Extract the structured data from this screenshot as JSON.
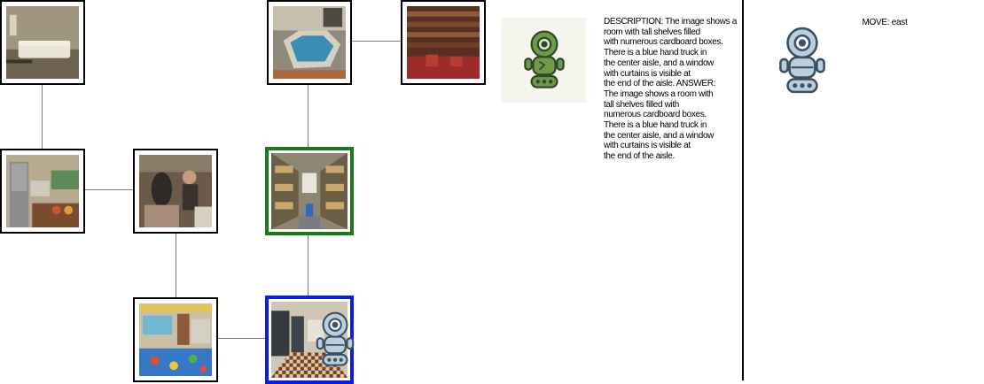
{
  "grid": {
    "nodes": [
      {
        "id": "living-room",
        "scene": "Living room with white sofa"
      },
      {
        "id": "indoor-pool",
        "scene": "Indoor hot tub room"
      },
      {
        "id": "library",
        "scene": "Library with red chairs"
      },
      {
        "id": "kitchen",
        "scene": "Kitchen with steel fridge"
      },
      {
        "id": "painting",
        "scene": "People in art room"
      },
      {
        "id": "storage-aisle",
        "scene": "Shelves with boxes",
        "status": "goal"
      },
      {
        "id": "classroom",
        "scene": "Classroom with rug"
      },
      {
        "id": "locker-room",
        "scene": "Locker room checkered floor",
        "status": "current"
      }
    ],
    "colors": {
      "goal_border": "#1a7a1a",
      "current_border": "#0a1ee0",
      "edge": "#7a7a7a"
    }
  },
  "agents": {
    "describer_icon": "green-robot-icon",
    "mover_icon": "blue-robot-icon",
    "describer_color": "#6e9a4a",
    "mover_color": "#b9cfdc"
  },
  "description_panel": {
    "text": "DESCRIPTION: The image shows a\nroom with tall shelves filled\nwith numerous cardboard boxes.\nThere is a blue hand truck in\nthe center aisle, and a window\nwith curtains is visible at\nthe end of the aisle.  ANSWER:\nThe image shows a room with\ntall shelves filled with\nnumerous cardboard boxes.\nThere is a blue hand truck in\nthe center aisle, and a window\nwith curtains is visible at\nthe end of the aisle."
  },
  "move_panel": {
    "label": "MOVE: east"
  }
}
